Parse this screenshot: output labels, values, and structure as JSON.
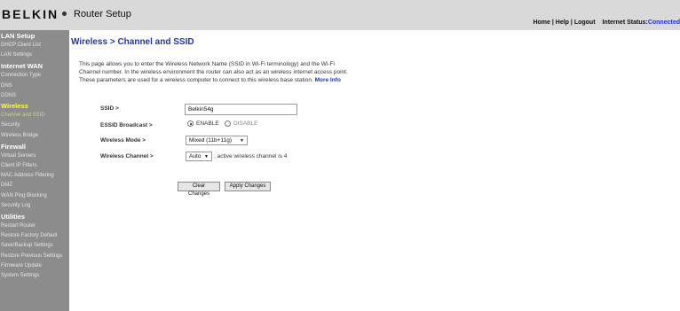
{
  "header": {
    "logo": "BELKIN",
    "title": "Router Setup",
    "links": {
      "home": "Home",
      "help": "Help",
      "logout": "Logout",
      "status_label": "Internet Status:",
      "status_value": "Connected"
    }
  },
  "sidebar": {
    "groups": [
      {
        "label": "LAN Setup",
        "items": [
          "DHCP Client List",
          "LAN Settings"
        ]
      },
      {
        "label": "Internet WAN",
        "items": [
          "Connection Type",
          "DNS",
          "DDNS"
        ]
      },
      {
        "label": "Wireless",
        "items": [
          "Channel and SSID",
          "Security",
          "Wireless Bridge"
        ]
      },
      {
        "label": "Firewall",
        "items": [
          "Virtual Servers",
          "Client IP Filters",
          "MAC Address Filtering",
          "DMZ",
          "WAN Ping Blocking",
          "Security Log"
        ]
      },
      {
        "label": "Utilities",
        "items": [
          "Restart Router",
          "Restore Factory Default",
          "Save/Backup Settings",
          "Restore Previous Settings",
          "Firmware Update",
          "System Settings"
        ]
      }
    ]
  },
  "main": {
    "title": "Wireless > Channel and SSID",
    "description": "This page allows you to enter the Wireless Network Name (SSID in Wi-Fi terminology) and the Wi-Fi Channel number. In the wireless environment the router can also act as an wireless internet access point. These parameters are used for a wireless computer to connect to this wireless base station.",
    "more_info": "More Info",
    "ssid_label": "SSID >",
    "ssid_value": "Belkin54g",
    "essid_label": "ESSID Broadcast >",
    "essid_enable": "ENABLE",
    "essid_disable": "DISABLE",
    "mode_label": "Wireless Mode >",
    "mode_value": "Mixed (11b+11g)",
    "channel_label": "Wireless Channel >",
    "channel_value": "Auto",
    "channel_note": ", active wireless channel is 4",
    "clear_button": "Clear Changes",
    "apply_button": "Apply Changes"
  }
}
